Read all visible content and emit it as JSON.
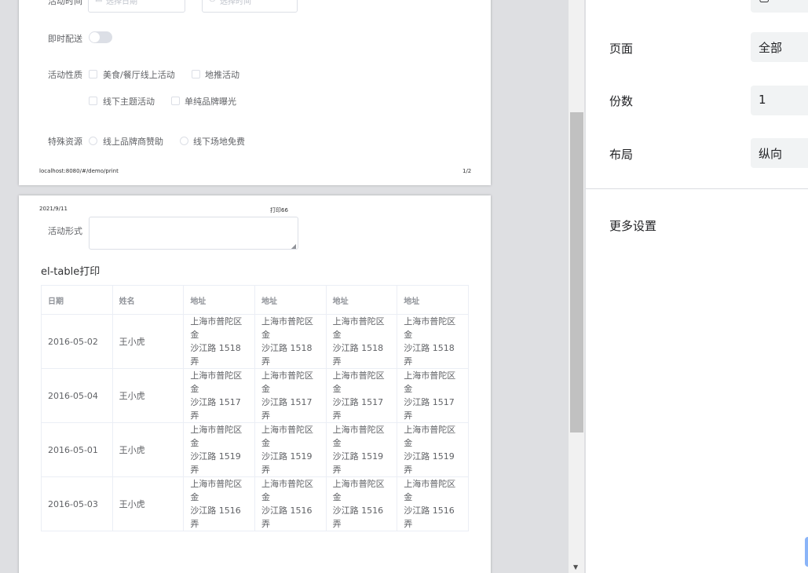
{
  "page1": {
    "activity_time_label": "活动时间",
    "date_placeholder": "选择日期",
    "time_placeholder": "选择时间",
    "instant_delivery_label": "即时配送",
    "nature_label": "活动性质",
    "nature_options": [
      "美食/餐厅线上活动",
      "地推活动",
      "线下主题活动",
      "单纯品牌曝光"
    ],
    "resource_label": "特殊资源",
    "resource_options": [
      "线上品牌商赞助",
      "线下场地免费"
    ],
    "footer_url": "localhost:8080/#/demo/print",
    "footer_page": "1/2"
  },
  "page2": {
    "header_date": "2021/9/11",
    "header_title": "打印66",
    "form_label": "活动形式",
    "table_title": "el-table打印",
    "table": {
      "headers": [
        "日期",
        "姓名",
        "地址",
        "地址",
        "地址",
        "地址"
      ],
      "rows": [
        {
          "date": "2016-05-02",
          "name": "王小虎",
          "addr_l1": "上海市普陀区金",
          "addr_l2": "沙江路 1518 弄"
        },
        {
          "date": "2016-05-04",
          "name": "王小虎",
          "addr_l1": "上海市普陀区金",
          "addr_l2": "沙江路 1517 弄"
        },
        {
          "date": "2016-05-01",
          "name": "王小虎",
          "addr_l1": "上海市普陀区金",
          "addr_l2": "沙江路 1519 弄"
        },
        {
          "date": "2016-05-03",
          "name": "王小虎",
          "addr_l1": "上海市普陀区金",
          "addr_l2": "沙江路 1516 弄"
        }
      ]
    }
  },
  "settings": {
    "pages_label": "页面",
    "pages_value": "全部",
    "copies_label": "份数",
    "copies_value": "1",
    "layout_label": "布局",
    "layout_value": "纵向",
    "more_label": "更多设置"
  }
}
